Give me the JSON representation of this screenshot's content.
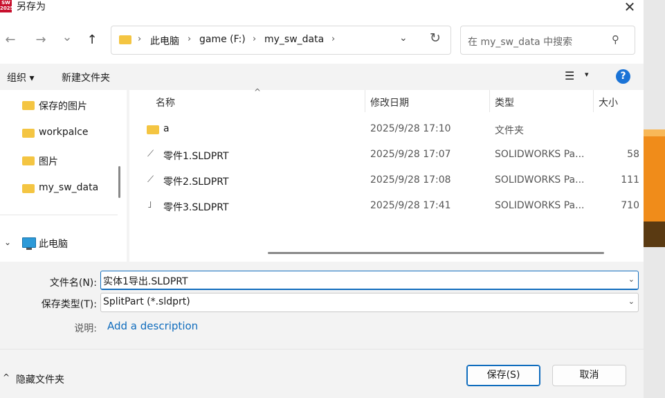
{
  "window": {
    "title": "另存为",
    "app_logo_text": "SW 2025",
    "close_glyph": "✕"
  },
  "nav": {
    "back_glyph": "←",
    "forward_glyph": "→",
    "recent_glyph": "⌄",
    "up_glyph": "↑",
    "breadcrumbs": [
      "此电脑",
      "game (F:)",
      "my_sw_data"
    ],
    "sep_glyph": "›",
    "dropdown_glyph": "⌄",
    "refresh_glyph": "↻"
  },
  "search": {
    "placeholder": "在 my_sw_data 中搜索",
    "icon_glyph": "⚲"
  },
  "toolbar": {
    "organize_label": "组织 ▾",
    "new_folder_label": "新建文件夹",
    "view_glyph": "☰",
    "view_dropdown_glyph": "▾",
    "help_glyph": "?"
  },
  "sidebar": {
    "items": [
      {
        "label": "保存的图片"
      },
      {
        "label": "workpalce"
      },
      {
        "label": "图片"
      },
      {
        "label": "my_sw_data"
      }
    ],
    "this_pc": {
      "label": "此电脑",
      "chevron": "⌄"
    }
  },
  "file_list": {
    "sort_glyph": "^",
    "columns": [
      "名称",
      "修改日期",
      "类型",
      "大小"
    ],
    "rows": [
      {
        "name": "a",
        "date": "2025/9/28 17:10",
        "type": "文件夹",
        "size": "",
        "kind": "folder"
      },
      {
        "name": "零件1.SLDPRT",
        "date": "2025/9/28 17:07",
        "type": "SOLIDWORKS Pa...",
        "size": "58",
        "kind": "part"
      },
      {
        "name": "零件2.SLDPRT",
        "date": "2025/9/28 17:08",
        "type": "SOLIDWORKS Pa...",
        "size": "111",
        "kind": "part"
      },
      {
        "name": "零件3.SLDPRT",
        "date": "2025/9/28 17:41",
        "type": "SOLIDWORKS Pa...",
        "size": "710",
        "kind": "part"
      }
    ]
  },
  "form": {
    "filename_label": "文件名(N):",
    "filename_value": "实体1导出.SLDPRT",
    "filetype_label": "保存类型(T):",
    "filetype_value": "SplitPart (*.sldprt)",
    "description_label": "说明:",
    "description_link": "Add a description",
    "caret_glyph": "⌄"
  },
  "footer": {
    "hide_folders_label": "隐藏文件夹",
    "hide_chevron": "^",
    "save_label": "保存(S)",
    "cancel_label": "取消"
  }
}
